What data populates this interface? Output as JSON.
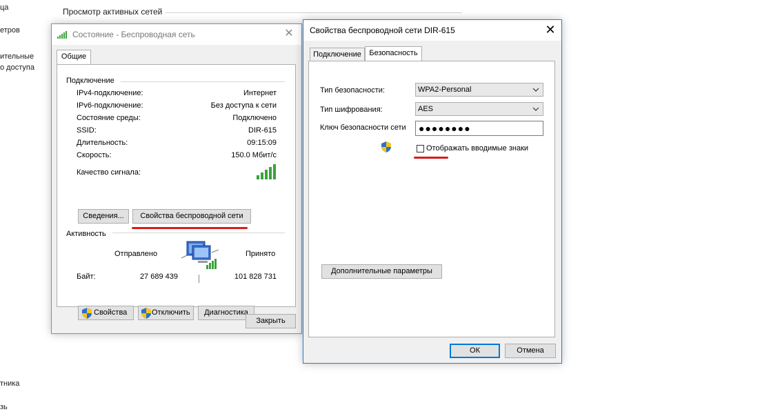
{
  "background": {
    "title": "Просмотр активных сетей",
    "left_fragments": [
      "ца",
      "етров",
      "ительные",
      "о доступа",
      "тника",
      "зь"
    ]
  },
  "status_window": {
    "title": "Состояние - Беспроводная сеть",
    "tab": "Общие",
    "connection_header": "Подключение",
    "rows": [
      {
        "label": "IPv4-подключение:",
        "value": "Интернет"
      },
      {
        "label": "IPv6-подключение:",
        "value": "Без доступа к сети"
      },
      {
        "label": "Состояние среды:",
        "value": "Подключено"
      },
      {
        "label": "SSID:",
        "value": "DIR-615"
      },
      {
        "label": "Длительность:",
        "value": "09:15:09"
      },
      {
        "label": "Скорость:",
        "value": "150.0 Мбит/с"
      }
    ],
    "signal_label": "Качество сигнала:",
    "details_button": "Сведения...",
    "wireless_props_button": "Свойства беспроводной сети",
    "activity_header": "Активность",
    "sent_label": "Отправлено",
    "received_label": "Принято",
    "bytes_label": "Байт:",
    "bytes_sent": "27 689 439",
    "bytes_received": "101 828 731",
    "properties_button": "Свойства",
    "disconnect_button": "Отключить",
    "diagnostics_button": "Диагностика",
    "close_button": "Закрыть"
  },
  "props_window": {
    "title": "Свойства беспроводной сети DIR-615",
    "tabs": [
      "Подключение",
      "Безопасность"
    ],
    "security_type_label": "Тип безопасности:",
    "security_type_value": "WPA2-Personal",
    "encryption_label": "Тип шифрования:",
    "encryption_value": "AES",
    "key_label": "Ключ безопасности сети",
    "key_value": "●●●●●●●●",
    "show_chars_label": "Отображать вводимые знаки",
    "advanced_button": "Дополнительные параметры",
    "ok_button": "ОК",
    "cancel_button": "Отмена"
  },
  "colors": {
    "accent": "#0078d7",
    "highlight_underline": "#d91b1b",
    "signal_green": "#3ba23b"
  }
}
